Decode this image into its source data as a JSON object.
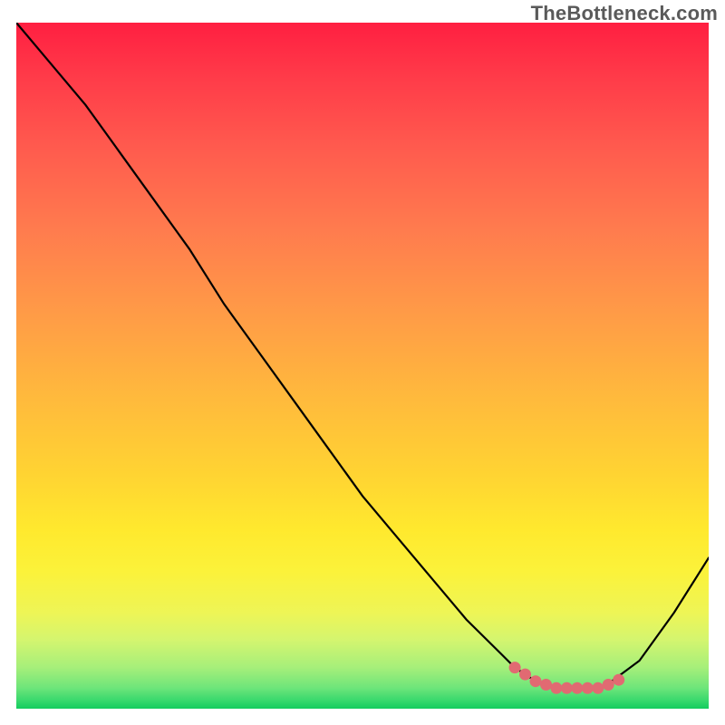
{
  "watermark": "TheBottleneck.com",
  "chart_data": {
    "type": "line",
    "title": "",
    "xlabel": "",
    "ylabel": "",
    "xlim": [
      0,
      100
    ],
    "ylim": [
      0,
      100
    ],
    "grid": false,
    "series": [
      {
        "name": "curve",
        "x": [
          0,
          5,
          10,
          15,
          20,
          25,
          30,
          35,
          40,
          45,
          50,
          55,
          60,
          65,
          70,
          72,
          75,
          78,
          80,
          82,
          84,
          86,
          90,
          95,
          100
        ],
        "y": [
          100,
          94,
          88,
          81,
          74,
          67,
          59,
          52,
          45,
          38,
          31,
          25,
          19,
          13,
          8,
          6,
          4,
          3,
          3,
          3,
          3,
          4,
          7,
          14,
          22
        ]
      }
    ],
    "highlight_points": {
      "name": "minimum-band-dots",
      "x": [
        72,
        73.5,
        75,
        76.5,
        78,
        79.5,
        81,
        82.5,
        84,
        85.5,
        87
      ],
      "y": [
        6,
        5,
        4,
        3.5,
        3,
        3,
        3,
        3,
        3,
        3.5,
        4.2
      ]
    },
    "gradient_bands": [
      {
        "pos": 0.0,
        "color": "#ff1f41"
      },
      {
        "pos": 0.3,
        "color": "#ff7b4e"
      },
      {
        "pos": 0.66,
        "color": "#ffd432"
      },
      {
        "pos": 0.86,
        "color": "#eef556"
      },
      {
        "pos": 1.0,
        "color": "#14cc5e"
      }
    ]
  }
}
